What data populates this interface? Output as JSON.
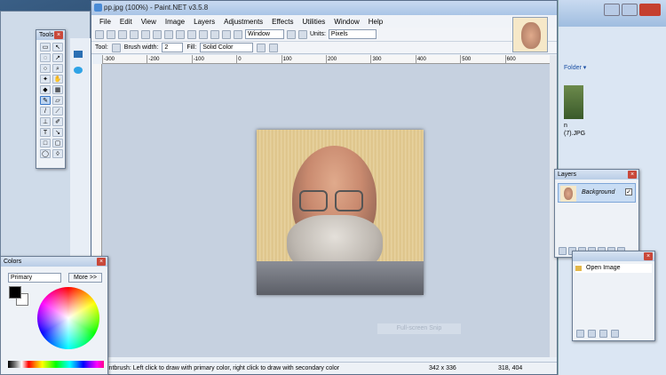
{
  "app": {
    "title": "pp.jpg (100%) - Paint.NET v3.5.8"
  },
  "menu": [
    "File",
    "Edit",
    "View",
    "Image",
    "Layers",
    "Adjustments",
    "Effects",
    "Utilities",
    "Window",
    "Help"
  ],
  "toolbar": {
    "zoom_value": "Window",
    "units_label": "Units:",
    "units_value": "Pixels"
  },
  "toolbar2": {
    "tool_label": "Tool:",
    "brush_width_label": "Brush width:",
    "brush_width_value": "2",
    "fill_label": "Fill:",
    "fill_value": "Solid Color"
  },
  "ruler": [
    "-300",
    "-200",
    "-100",
    "0",
    "100",
    "200",
    "300",
    "400",
    "500",
    "600"
  ],
  "status": {
    "hint": "intbrush: Left click to draw with primary color, right click to draw with secondary color",
    "image_size": "342 x 336",
    "cursor_pos": "318, 404"
  },
  "snip_watermark": "Full-screen Snip",
  "tools_panel": {
    "title": "Tools",
    "tools": [
      "rect-select",
      "move",
      "lasso",
      "move-selection",
      "ellipse-select",
      "zoom",
      "magic-wand",
      "pan",
      "paint-bucket",
      "gradient",
      "paintbrush",
      "eraser",
      "pencil",
      "color-picker",
      "clone-stamp",
      "recolor",
      "text",
      "line",
      "rectangle",
      "rounded-rect",
      "ellipse",
      "freeform"
    ]
  },
  "colors_panel": {
    "title": "Colors",
    "mode": "Primary",
    "more_label": "More >>",
    "primary_color": "#000000",
    "secondary_color": "#ffffff"
  },
  "layers_panel": {
    "title": "Layers",
    "layer_name": "Background"
  },
  "history_panel": {
    "entry": "Open Image"
  },
  "bg_explorer": {
    "folder_label": "Folder ▾",
    "caption_line1": "n",
    "caption_line2": "(7).JPG"
  }
}
